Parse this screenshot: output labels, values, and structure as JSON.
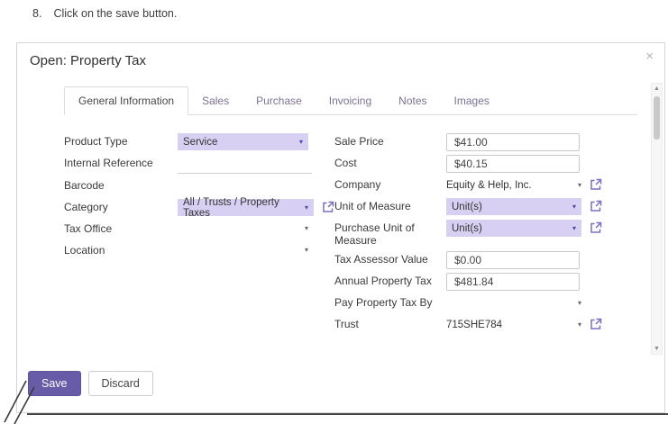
{
  "instruction": {
    "number": "8.",
    "text": "Click on the save button."
  },
  "icons": {
    "caret_down": "▾",
    "close": "×",
    "scroll_up": "▲",
    "scroll_down": "▼",
    "external_link": "↗"
  },
  "colors": {
    "highlight": "#d8d0f2",
    "primary_button": "#685ca8",
    "link_icon": "#7a6fbe"
  },
  "modal": {
    "title": "Open: Property Tax",
    "tabs": [
      {
        "label": "General Information",
        "active": true
      },
      {
        "label": "Sales",
        "active": false
      },
      {
        "label": "Purchase",
        "active": false
      },
      {
        "label": "Invoicing",
        "active": false
      },
      {
        "label": "Notes",
        "active": false
      },
      {
        "label": "Images",
        "active": false
      }
    ],
    "form": {
      "left": [
        {
          "label": "Product Type",
          "value": "Service"
        },
        {
          "label": "Internal Reference",
          "value": ""
        },
        {
          "label": "Barcode",
          "value": ""
        },
        {
          "label": "Category",
          "value": "All / Trusts / Property Taxes"
        },
        {
          "label": "Tax Office",
          "value": ""
        },
        {
          "label": "Location",
          "value": ""
        }
      ],
      "right": [
        {
          "label": "Sale Price",
          "value": "$41.00"
        },
        {
          "label": "Cost",
          "value": "$40.15"
        },
        {
          "label": "Company",
          "value": "Equity & Help, Inc."
        },
        {
          "label": "Unit of Measure",
          "value": "Unit(s)"
        },
        {
          "label": "Purchase Unit of Measure",
          "value": "Unit(s)"
        },
        {
          "label": "Tax Assessor Value",
          "value": "$0.00"
        },
        {
          "label": "Annual Property Tax",
          "value": "$481.84"
        },
        {
          "label": "Pay Property Tax By",
          "value": ""
        },
        {
          "label": "Trust",
          "value": "715SHE784"
        }
      ]
    },
    "footer": {
      "save_label": "Save",
      "discard_label": "Discard"
    }
  }
}
